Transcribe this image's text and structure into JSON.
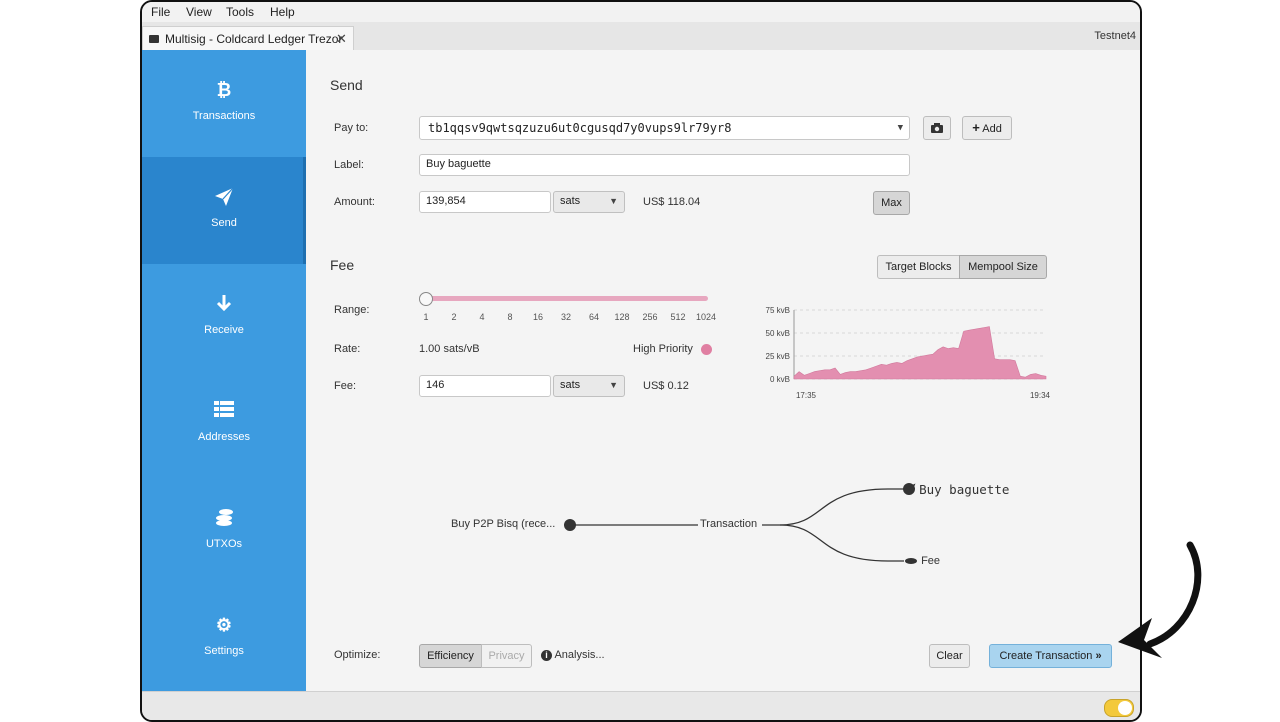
{
  "menu": [
    "File",
    "View",
    "Tools",
    "Help"
  ],
  "tab": {
    "title": "Multisig - Coldcard Ledger Trezor",
    "close": "✕"
  },
  "network": "Testnet4",
  "sidebar": {
    "items": [
      {
        "label": "Transactions",
        "icon": "bitcoin-icon",
        "glyph": "₿"
      },
      {
        "label": "Send",
        "icon": "paper-plane-icon",
        "glyph": "➤"
      },
      {
        "label": "Receive",
        "icon": "arrow-down-icon",
        "glyph": "🡇"
      },
      {
        "label": "Addresses",
        "icon": "table-icon",
        "glyph": "☷"
      },
      {
        "label": "UTXOs",
        "icon": "coins-icon",
        "glyph": "🪙"
      },
      {
        "label": "Settings",
        "icon": "gear-icon",
        "glyph": "⚙"
      }
    ],
    "active": "Send"
  },
  "send": {
    "title": "Send",
    "pay_to_label": "Pay to:",
    "pay_to_value": "tb1qqsv9qwtsqzuzu6ut0cgusqd7y0vups9lr79yr8",
    "add_label": "Add",
    "label_label": "Label:",
    "label_value": "Buy baguette",
    "amount_label": "Amount:",
    "amount_value": "139,854",
    "amount_unit": "sats",
    "amount_fiat": "US$ 118.04",
    "max_label": "Max"
  },
  "fee": {
    "title": "Fee",
    "toggle_target": "Target Blocks",
    "toggle_mempool": "Mempool Size",
    "range_label": "Range:",
    "range_ticks": [
      "1",
      "2",
      "4",
      "8",
      "16",
      "32",
      "64",
      "128",
      "256",
      "512",
      "1024"
    ],
    "rate_label": "Rate:",
    "rate_value": "1.00 sats/vB",
    "priority": "High Priority",
    "priority_color": "#e07fa2",
    "fee_label": "Fee:",
    "fee_value": "146",
    "fee_unit": "sats",
    "fee_fiat": "US$ 0.12"
  },
  "chart_data": {
    "type": "area",
    "y_ticks": [
      "75 kvB",
      "50 kvB",
      "25 kvB",
      "0 kvB"
    ],
    "ylim": [
      0,
      75
    ],
    "x_labels": [
      "17:35",
      "19:34"
    ],
    "grid": true,
    "color": "#e38fb0",
    "values": [
      3,
      8,
      4,
      6,
      8,
      9,
      10,
      10,
      12,
      5,
      7,
      8,
      8,
      9,
      10,
      12,
      14,
      16,
      15,
      17,
      18,
      17,
      20,
      22,
      24,
      25,
      26,
      27,
      32,
      35,
      33,
      34,
      33,
      52,
      53,
      54,
      55,
      56,
      57,
      22,
      21,
      21,
      21,
      20,
      3,
      2,
      5,
      6,
      4,
      3
    ]
  },
  "diagram": {
    "input": "Buy P2P Bisq (rece...",
    "center": "Transaction",
    "output1": "Buy baguette",
    "output2": "Fee"
  },
  "footer": {
    "optimize_label": "Optimize:",
    "efficiency": "Efficiency",
    "privacy": "Privacy",
    "analysis": "Analysis...",
    "clear": "Clear",
    "create": "Create Transaction"
  }
}
